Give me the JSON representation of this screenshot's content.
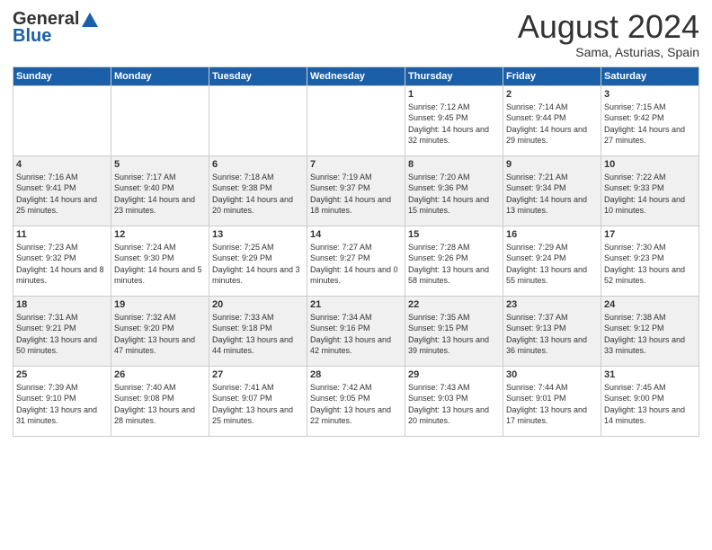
{
  "header": {
    "logo_general": "General",
    "logo_blue": "Blue",
    "month_title": "August 2024",
    "location": "Sama, Asturias, Spain"
  },
  "weekdays": [
    "Sunday",
    "Monday",
    "Tuesday",
    "Wednesday",
    "Thursday",
    "Friday",
    "Saturday"
  ],
  "rows": [
    {
      "cells": [
        {
          "empty": true
        },
        {
          "empty": true
        },
        {
          "empty": true
        },
        {
          "empty": true
        },
        {
          "day": "1",
          "sunrise": "7:12 AM",
          "sunset": "9:45 PM",
          "daylight": "14 hours and 32 minutes."
        },
        {
          "day": "2",
          "sunrise": "7:14 AM",
          "sunset": "9:44 PM",
          "daylight": "14 hours and 29 minutes."
        },
        {
          "day": "3",
          "sunrise": "7:15 AM",
          "sunset": "9:42 PM",
          "daylight": "14 hours and 27 minutes."
        }
      ]
    },
    {
      "cells": [
        {
          "day": "4",
          "sunrise": "7:16 AM",
          "sunset": "9:41 PM",
          "daylight": "14 hours and 25 minutes."
        },
        {
          "day": "5",
          "sunrise": "7:17 AM",
          "sunset": "9:40 PM",
          "daylight": "14 hours and 23 minutes."
        },
        {
          "day": "6",
          "sunrise": "7:18 AM",
          "sunset": "9:38 PM",
          "daylight": "14 hours and 20 minutes."
        },
        {
          "day": "7",
          "sunrise": "7:19 AM",
          "sunset": "9:37 PM",
          "daylight": "14 hours and 18 minutes."
        },
        {
          "day": "8",
          "sunrise": "7:20 AM",
          "sunset": "9:36 PM",
          "daylight": "14 hours and 15 minutes."
        },
        {
          "day": "9",
          "sunrise": "7:21 AM",
          "sunset": "9:34 PM",
          "daylight": "14 hours and 13 minutes."
        },
        {
          "day": "10",
          "sunrise": "7:22 AM",
          "sunset": "9:33 PM",
          "daylight": "14 hours and 10 minutes."
        }
      ]
    },
    {
      "cells": [
        {
          "day": "11",
          "sunrise": "7:23 AM",
          "sunset": "9:32 PM",
          "daylight": "14 hours and 8 minutes."
        },
        {
          "day": "12",
          "sunrise": "7:24 AM",
          "sunset": "9:30 PM",
          "daylight": "14 hours and 5 minutes."
        },
        {
          "day": "13",
          "sunrise": "7:25 AM",
          "sunset": "9:29 PM",
          "daylight": "14 hours and 3 minutes."
        },
        {
          "day": "14",
          "sunrise": "7:27 AM",
          "sunset": "9:27 PM",
          "daylight": "14 hours and 0 minutes."
        },
        {
          "day": "15",
          "sunrise": "7:28 AM",
          "sunset": "9:26 PM",
          "daylight": "13 hours and 58 minutes."
        },
        {
          "day": "16",
          "sunrise": "7:29 AM",
          "sunset": "9:24 PM",
          "daylight": "13 hours and 55 minutes."
        },
        {
          "day": "17",
          "sunrise": "7:30 AM",
          "sunset": "9:23 PM",
          "daylight": "13 hours and 52 minutes."
        }
      ]
    },
    {
      "cells": [
        {
          "day": "18",
          "sunrise": "7:31 AM",
          "sunset": "9:21 PM",
          "daylight": "13 hours and 50 minutes."
        },
        {
          "day": "19",
          "sunrise": "7:32 AM",
          "sunset": "9:20 PM",
          "daylight": "13 hours and 47 minutes."
        },
        {
          "day": "20",
          "sunrise": "7:33 AM",
          "sunset": "9:18 PM",
          "daylight": "13 hours and 44 minutes."
        },
        {
          "day": "21",
          "sunrise": "7:34 AM",
          "sunset": "9:16 PM",
          "daylight": "13 hours and 42 minutes."
        },
        {
          "day": "22",
          "sunrise": "7:35 AM",
          "sunset": "9:15 PM",
          "daylight": "13 hours and 39 minutes."
        },
        {
          "day": "23",
          "sunrise": "7:37 AM",
          "sunset": "9:13 PM",
          "daylight": "13 hours and 36 minutes."
        },
        {
          "day": "24",
          "sunrise": "7:38 AM",
          "sunset": "9:12 PM",
          "daylight": "13 hours and 33 minutes."
        }
      ]
    },
    {
      "cells": [
        {
          "day": "25",
          "sunrise": "7:39 AM",
          "sunset": "9:10 PM",
          "daylight": "13 hours and 31 minutes."
        },
        {
          "day": "26",
          "sunrise": "7:40 AM",
          "sunset": "9:08 PM",
          "daylight": "13 hours and 28 minutes."
        },
        {
          "day": "27",
          "sunrise": "7:41 AM",
          "sunset": "9:07 PM",
          "daylight": "13 hours and 25 minutes."
        },
        {
          "day": "28",
          "sunrise": "7:42 AM",
          "sunset": "9:05 PM",
          "daylight": "13 hours and 22 minutes."
        },
        {
          "day": "29",
          "sunrise": "7:43 AM",
          "sunset": "9:03 PM",
          "daylight": "13 hours and 20 minutes."
        },
        {
          "day": "30",
          "sunrise": "7:44 AM",
          "sunset": "9:01 PM",
          "daylight": "13 hours and 17 minutes."
        },
        {
          "day": "31",
          "sunrise": "7:45 AM",
          "sunset": "9:00 PM",
          "daylight": "13 hours and 14 minutes."
        }
      ]
    }
  ],
  "labels": {
    "sunrise": "Sunrise:",
    "sunset": "Sunset:",
    "daylight": "Daylight:"
  }
}
